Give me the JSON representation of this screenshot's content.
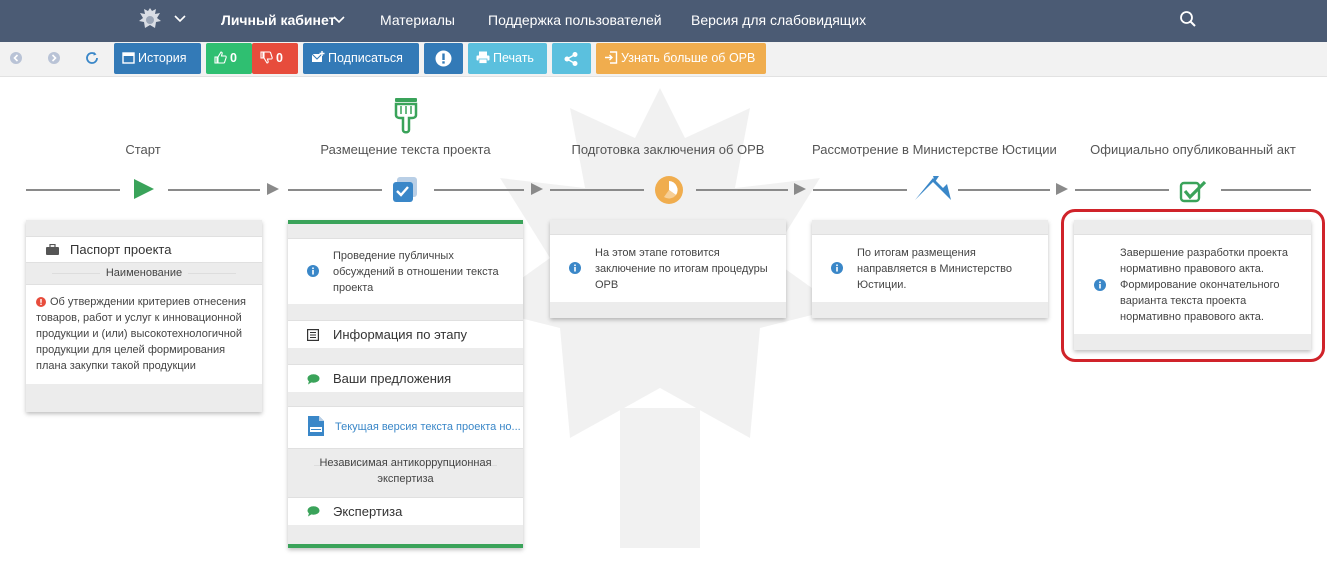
{
  "nav": {
    "cabinet": "Личный кабинет",
    "materials": "Материалы",
    "support": "Поддержка пользователей",
    "accessible": "Версия для слабовидящих"
  },
  "toolbar": {
    "history": "История",
    "likes": "0",
    "dislikes": "0",
    "subscribe": "Подписаться",
    "print": "Печать",
    "learn_more": "Узнать больше об ОРВ"
  },
  "stages": [
    {
      "title": "Старт"
    },
    {
      "title": "Размещение текста проекта"
    },
    {
      "title": "Подготовка заключения об ОРВ"
    },
    {
      "title": "Рассмотрение в Министерстве Юстиции"
    },
    {
      "title": "Официально опубликованный акт"
    }
  ],
  "card1": {
    "passport": "Паспорт проекта",
    "name_header": "Наименование",
    "name_text": "Об утверждении критериев отнесения товаров, работ и услуг к инновационной продукции и (или) высокотехнологичной продукции для целей формирования плана закупки такой продукции"
  },
  "card2": {
    "info_text": "Проведение публичных обсуждений в отношении текста проекта",
    "stage_info": "Информация по этапу",
    "proposals": "Ваши предложения",
    "current_version": "Текущая версия текста проекта но...",
    "anticorruption": "Независимая антикоррупционная экспертиза",
    "expertise": "Экспертиза"
  },
  "card3": {
    "info_text": "На этом этапе готовится заключение по итогам процедуры ОРВ"
  },
  "card4": {
    "info_text": "По итогам размещения направляется в Министерство Юстиции."
  },
  "card5": {
    "info_text": "Завершение разработки проекта нормативно правового акта. Формирование окончательного варианта текста проекта нормативно правового акта."
  },
  "colors": {
    "nav_bg": "#4b5b74",
    "primary": "#337ab7",
    "success": "#2fbf71",
    "danger": "#e74c3c",
    "info": "#5bc0de",
    "warning": "#f0ad4e",
    "highlight": "#d0232a"
  }
}
